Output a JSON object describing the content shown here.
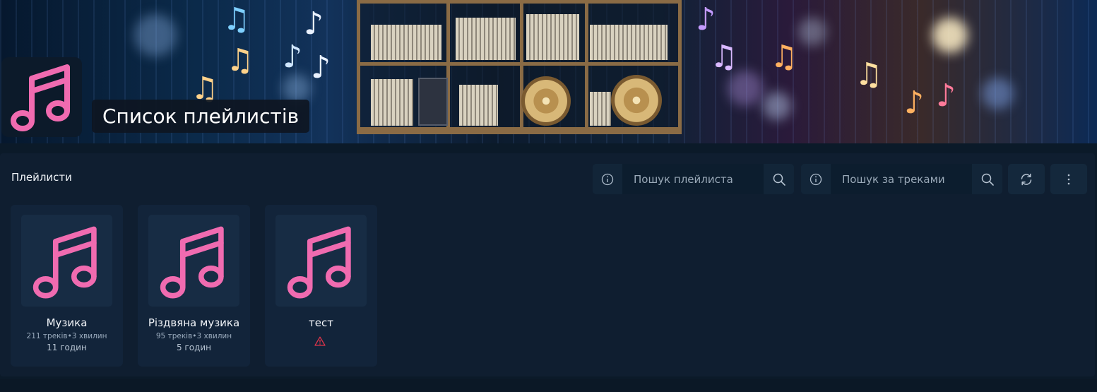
{
  "banner": {
    "title": "Список плейлистів"
  },
  "section": {
    "title": "Плейлисти"
  },
  "search_playlists": {
    "placeholder": "Пошук плейлиста"
  },
  "search_tracks": {
    "placeholder": "Пошук за треками"
  },
  "icons": {
    "logo": "music-note-icon",
    "info": "info-circle-icon",
    "search": "search-icon",
    "refresh": "refresh-icon",
    "menu": "vertical-dots-icon",
    "warning": "warning-triangle-icon"
  },
  "colors": {
    "accent": "#f06bb0",
    "warning": "#e0344a",
    "panel": "#0f1e30"
  },
  "playlists": [
    {
      "name": "Музика",
      "meta": "211 треків•3 хвилин",
      "duration": "11 годин"
    },
    {
      "name": "Різдвяна музика",
      "meta": "95 треків•3 хвилин",
      "duration": "5 годин"
    },
    {
      "name": "тест",
      "meta": "",
      "duration": ""
    }
  ]
}
